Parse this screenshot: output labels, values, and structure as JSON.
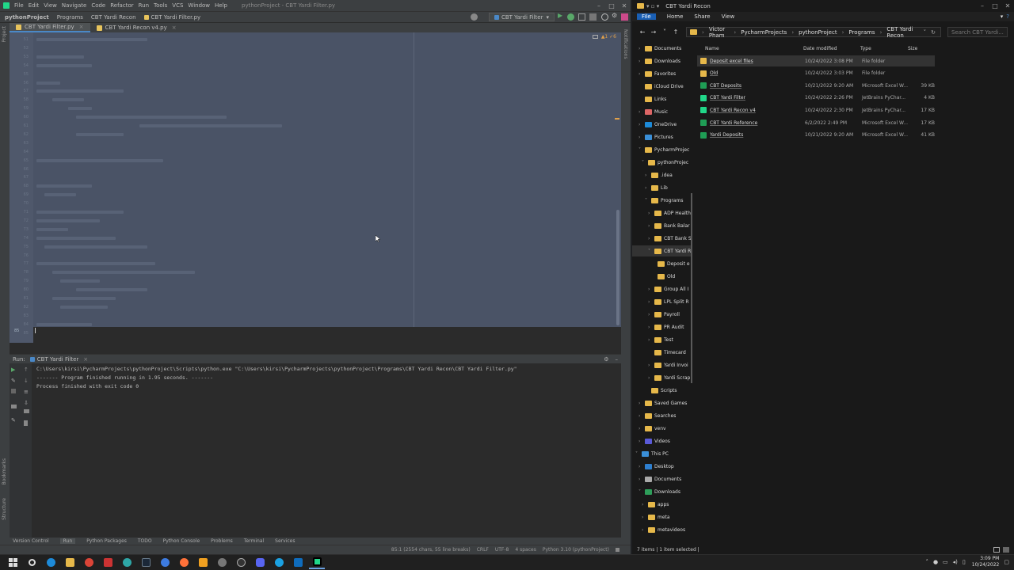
{
  "pycharm": {
    "menu": [
      "File",
      "Edit",
      "View",
      "Navigate",
      "Code",
      "Refactor",
      "Run",
      "Tools",
      "VCS",
      "Window",
      "Help"
    ],
    "window_title": "pythonProject - CBT Yardi Filter.py",
    "breadcrumbs": [
      "pythonProject",
      "Programs",
      "CBT Yardi Recon",
      "CBT Yardi Filter.py"
    ],
    "run_config": "CBT Yardi Filter",
    "tabs": [
      "CBT Yardi Filter.py",
      "CBT Yardi Recon v4.py"
    ],
    "inspection": "▲1 ✓6",
    "left_strip": "Project",
    "right_strip": "Notifications",
    "gutter_last_line": "85",
    "line_numbers": [
      "51",
      "52",
      "53",
      "54",
      "55",
      "56",
      "57",
      "58",
      "59",
      "60",
      "61",
      "62",
      "63",
      "64",
      "65",
      "66",
      "67",
      "68",
      "69",
      "70",
      "71",
      "72",
      "73",
      "74",
      "75",
      "76",
      "77",
      "78",
      "79",
      "80",
      "81",
      "82",
      "83",
      "84",
      "85"
    ],
    "run_header": {
      "label": "Run:",
      "tab": "CBT Yardi Filter"
    },
    "run_output": [
      "C:\\Users\\kirsi\\PycharmProjects\\pythonProject\\Scripts\\python.exe \"C:\\Users\\kirsi\\PycharmProjects\\pythonProject\\Programs\\CBT Yardi Recon\\CBT Yardi Filter.py\"",
      "------- Program finished running in 1.95 seconds. -------",
      "",
      "Process finished with exit code 0"
    ],
    "left_bottom_strip": [
      "Bookmarks",
      "Structure"
    ],
    "bottom_tools": [
      "Version Control",
      "Run",
      "Python Packages",
      "TODO",
      "Python Console",
      "Problems",
      "Terminal",
      "Services"
    ],
    "status": [
      "85:1 (2554 chars, 55 line breaks)",
      "CRLF",
      "UTF-8",
      "4 spaces",
      "Python 3.10 (pythonProject)"
    ]
  },
  "explorer": {
    "title": "CBT Yardi Recon",
    "ribbon": [
      "File",
      "Home",
      "Share",
      "View"
    ],
    "address": [
      "Victor Pham",
      "PycharmProjects",
      "pythonProject",
      "Programs",
      "CBT Yardi Recon"
    ],
    "search_placeholder": "Search CBT Yardi...",
    "tree": [
      "Documents",
      "Downloads",
      "Favorites",
      "iCloud Drive",
      "Links",
      "Music",
      "OneDrive",
      "Pictures",
      "PycharmProjec",
      "pythonProjec",
      ".idea",
      "Lib",
      "Programs",
      "ADP Health",
      "Bank Balar",
      "CBT Bank S",
      "CBT Yardi R",
      "Deposit e",
      "Old",
      "Group All I",
      "LPL Split R",
      "Payroll",
      "PR Audit",
      "Test",
      "Timecard",
      "Yardi Invoi",
      "Yardi Scrap",
      "Scripts",
      "Saved Games",
      "Searches",
      "venv",
      "Videos",
      "This PC",
      "Desktop",
      "Documents",
      "Downloads",
      "apps",
      "meta",
      "metavideos"
    ],
    "columns": [
      "Name",
      "Date modified",
      "Type",
      "Size"
    ],
    "files": [
      {
        "name": "Deposit excel files",
        "date": "10/24/2022 3:08 PM",
        "type": "File folder",
        "size": ""
      },
      {
        "name": "Old",
        "date": "10/24/2022 3:03 PM",
        "type": "File folder",
        "size": ""
      },
      {
        "name": "CBT Deposits",
        "date": "10/21/2022 9:20 AM",
        "type": "Microsoft Excel W...",
        "size": "39 KB"
      },
      {
        "name": "CBT Yardi Filter",
        "date": "10/24/2022 2:26 PM",
        "type": "JetBrains PyChar...",
        "size": "4 KB"
      },
      {
        "name": "CBT Yardi Recon v4",
        "date": "10/24/2022 2:30 PM",
        "type": "JetBrains PyChar...",
        "size": "17 KB"
      },
      {
        "name": "CBT Yardi Reference",
        "date": "6/2/2022 2:49 PM",
        "type": "Microsoft Excel W...",
        "size": "17 KB"
      },
      {
        "name": "Yardi Deposits",
        "date": "10/21/2022 9:20 AM",
        "type": "Microsoft Excel W...",
        "size": "41 KB"
      }
    ],
    "status": "7 items  |  1 item selected  |"
  },
  "taskbar": {
    "time": "3:09 PM",
    "date": "10/24/2022"
  },
  "colors": {
    "editor_bg": "#4a5366",
    "folder": "#e6b84a",
    "excel": "#1f9d55",
    "pycharm": "#21d789"
  }
}
